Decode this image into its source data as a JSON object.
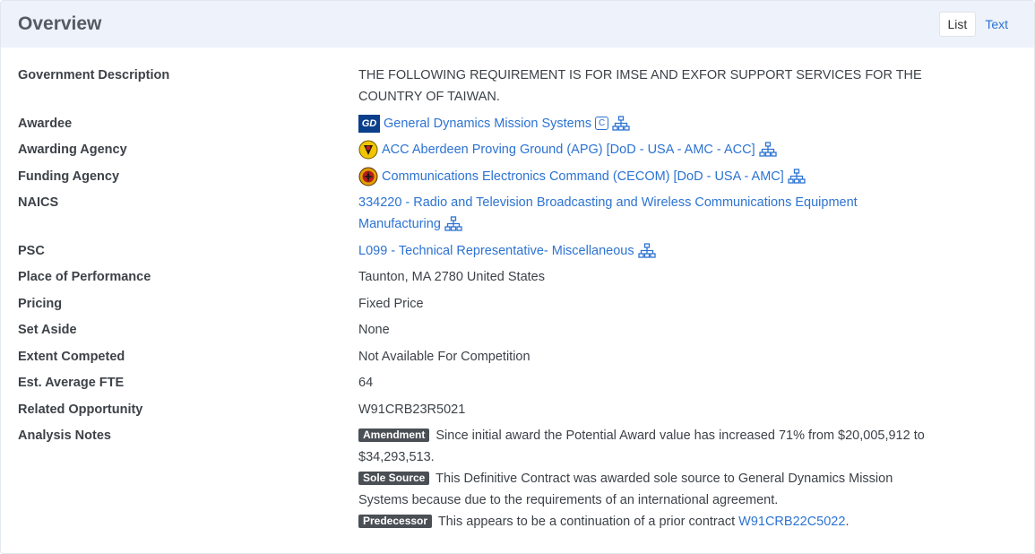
{
  "header": {
    "title": "Overview",
    "view_list": "List",
    "view_text": "Text"
  },
  "rows": {
    "gov_desc": {
      "label": "Government Description",
      "value": "THE FOLLOWING REQUIREMENT IS FOR IMSE AND EXFOR SUPPORT SERVICES FOR THE COUNTRY OF TAIWAN."
    },
    "awardee": {
      "label": "Awardee",
      "logo_text": "GD",
      "value": "General Dynamics Mission Systems",
      "badge": "C"
    },
    "awarding_agency": {
      "label": "Awarding Agency",
      "value": "ACC Aberdeen Proving Ground (APG) [DoD - USA - AMC - ACC]"
    },
    "funding_agency": {
      "label": "Funding Agency",
      "value": "Communications Electronics Command (CECOM) [DoD - USA - AMC]"
    },
    "naics": {
      "label": "NAICS",
      "value": "334220 - Radio and Television Broadcasting and Wireless Communications Equipment Manufacturing"
    },
    "psc": {
      "label": "PSC",
      "value": "L099 - Technical Representative- Miscellaneous"
    },
    "place": {
      "label": "Place of Performance",
      "value": "Taunton, MA 2780 United States"
    },
    "pricing": {
      "label": "Pricing",
      "value": "Fixed Price"
    },
    "set_aside": {
      "label": "Set Aside",
      "value": "None"
    },
    "extent": {
      "label": "Extent Competed",
      "value": "Not Available For Competition"
    },
    "fte": {
      "label": "Est. Average FTE",
      "value": "64"
    },
    "related": {
      "label": "Related Opportunity",
      "value": "W91CRB23R5021"
    },
    "notes": {
      "label": "Analysis Notes",
      "amendment_badge": "Amendment",
      "amendment_text": "Since initial award the Potential Award value has increased 71% from $20,005,912 to $34,293,513.",
      "sole_badge": "Sole Source",
      "sole_text": "This Definitive Contract was awarded sole source to General Dynamics Mission Systems because due to the requirements of an international agreement.",
      "pred_badge": "Predecessor",
      "pred_text": "This appears to be a continuation of a prior contract",
      "pred_link": "W91CRB22C5022",
      "pred_end": "."
    }
  },
  "colors": {
    "link": "#2c73d2",
    "header_bg": "#edf2fb",
    "badge_bg": "#4a4f55"
  },
  "icons": {
    "hierarchy": "org-hierarchy-icon",
    "awardee_logo": "gd-logo",
    "army_seal": "army-seal-icon",
    "cecom_seal": "cecom-seal-icon"
  }
}
